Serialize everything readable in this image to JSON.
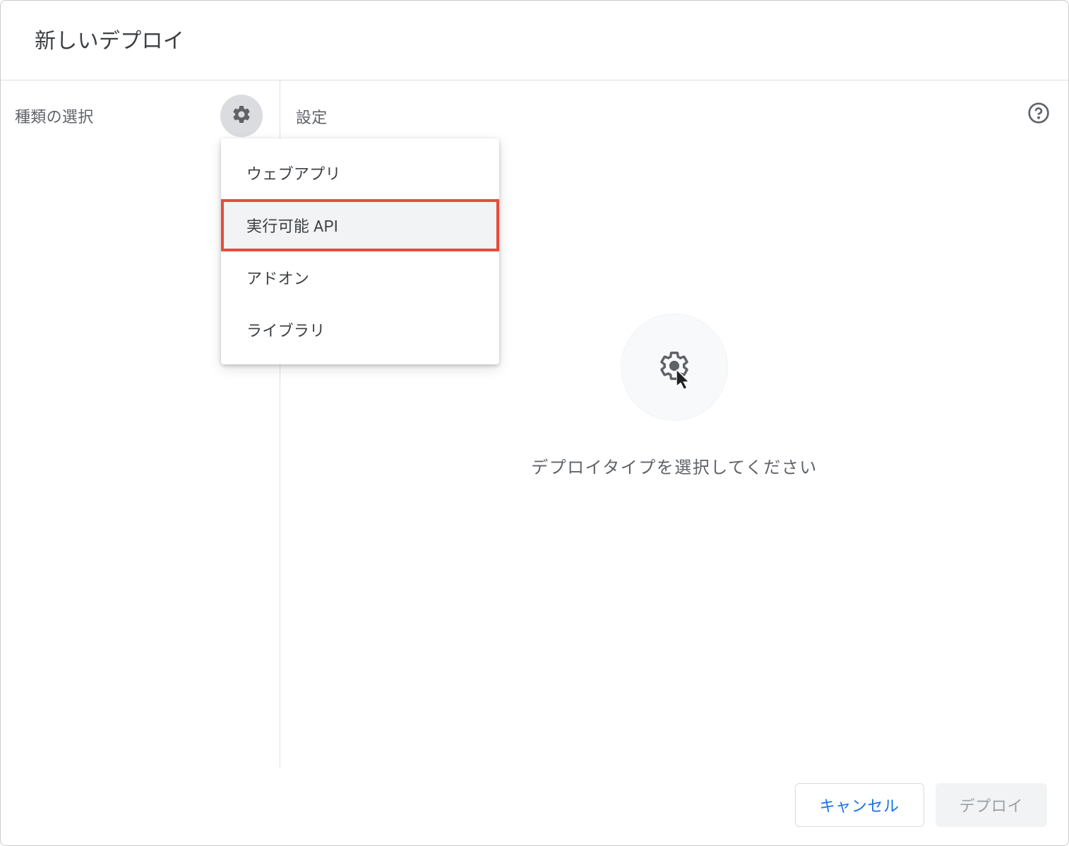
{
  "dialog": {
    "title": "新しいデプロイ"
  },
  "leftPanel": {
    "label": "種類の選択"
  },
  "rightPanel": {
    "settingsLabel": "設定",
    "emptyStateText": "デプロイタイプを選択してください"
  },
  "dropdown": {
    "items": [
      {
        "label": "ウェブアプリ",
        "highlighted": false
      },
      {
        "label": "実行可能 API",
        "highlighted": true
      },
      {
        "label": "アドオン",
        "highlighted": false
      },
      {
        "label": "ライブラリ",
        "highlighted": false
      }
    ]
  },
  "footer": {
    "cancelLabel": "キャンセル",
    "deployLabel": "デプロイ"
  }
}
